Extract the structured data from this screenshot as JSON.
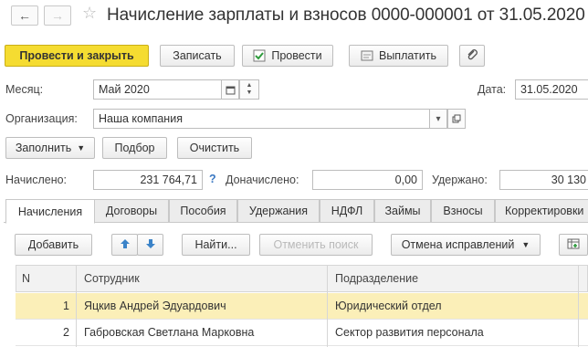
{
  "nav": {
    "back_glyph": "←",
    "forward_glyph": "→",
    "favorite_glyph": "☆"
  },
  "title": "Начисление зарплаты и взносов 0000-000001 от 31.05.2020",
  "toolbar": {
    "post_close": "Провести и закрыть",
    "save": "Записать",
    "post": "Провести",
    "pay": "Выплатить"
  },
  "form": {
    "month_label": "Месяц:",
    "month_value": "Май 2020",
    "date_label": "Дата:",
    "date_value": "31.05.2020",
    "org_label": "Организация:",
    "org_value": "Наша компания"
  },
  "actions": {
    "fill": "Заполнить",
    "select": "Подбор",
    "clear": "Очистить"
  },
  "totals": {
    "accrued_label": "Начислено:",
    "accrued_value": "231 764,71",
    "help_glyph": "?",
    "additional_label": "Доначислено:",
    "additional_value": "0,00",
    "withheld_label": "Удержано:",
    "withheld_value": "30 130"
  },
  "tabs": [
    "Начисления",
    "Договоры",
    "Пособия",
    "Удержания",
    "НДФЛ",
    "Займы",
    "Взносы",
    "Корректировки"
  ],
  "table_toolbar": {
    "add": "Добавить",
    "find": "Найти...",
    "cancel_search": "Отменить поиск",
    "cancel_corrections": "Отмена исправлений"
  },
  "table": {
    "columns": [
      "N",
      "Сотрудник",
      "Подразделение"
    ],
    "rows": [
      {
        "n": "1",
        "employee": "Яцкив Андрей Эдуардович",
        "department": "Юридический отдел"
      },
      {
        "n": "2",
        "employee": "Габровская Светлана Марковна",
        "department": "Сектор развития персонала"
      }
    ]
  },
  "colors": {
    "primary_button": "#f5dc31",
    "selected_row": "#fbefb8",
    "arrow_blue": "#3b83c8"
  },
  "icons": [
    "back-arrow-icon",
    "forward-arrow-icon",
    "star-icon",
    "post-icon",
    "pay-icon",
    "paperclip-icon",
    "calendar-icon",
    "spinner-icon",
    "dropdown-icon",
    "open-icon",
    "up-arrow-icon",
    "down-arrow-icon",
    "table-settings-icon"
  ]
}
